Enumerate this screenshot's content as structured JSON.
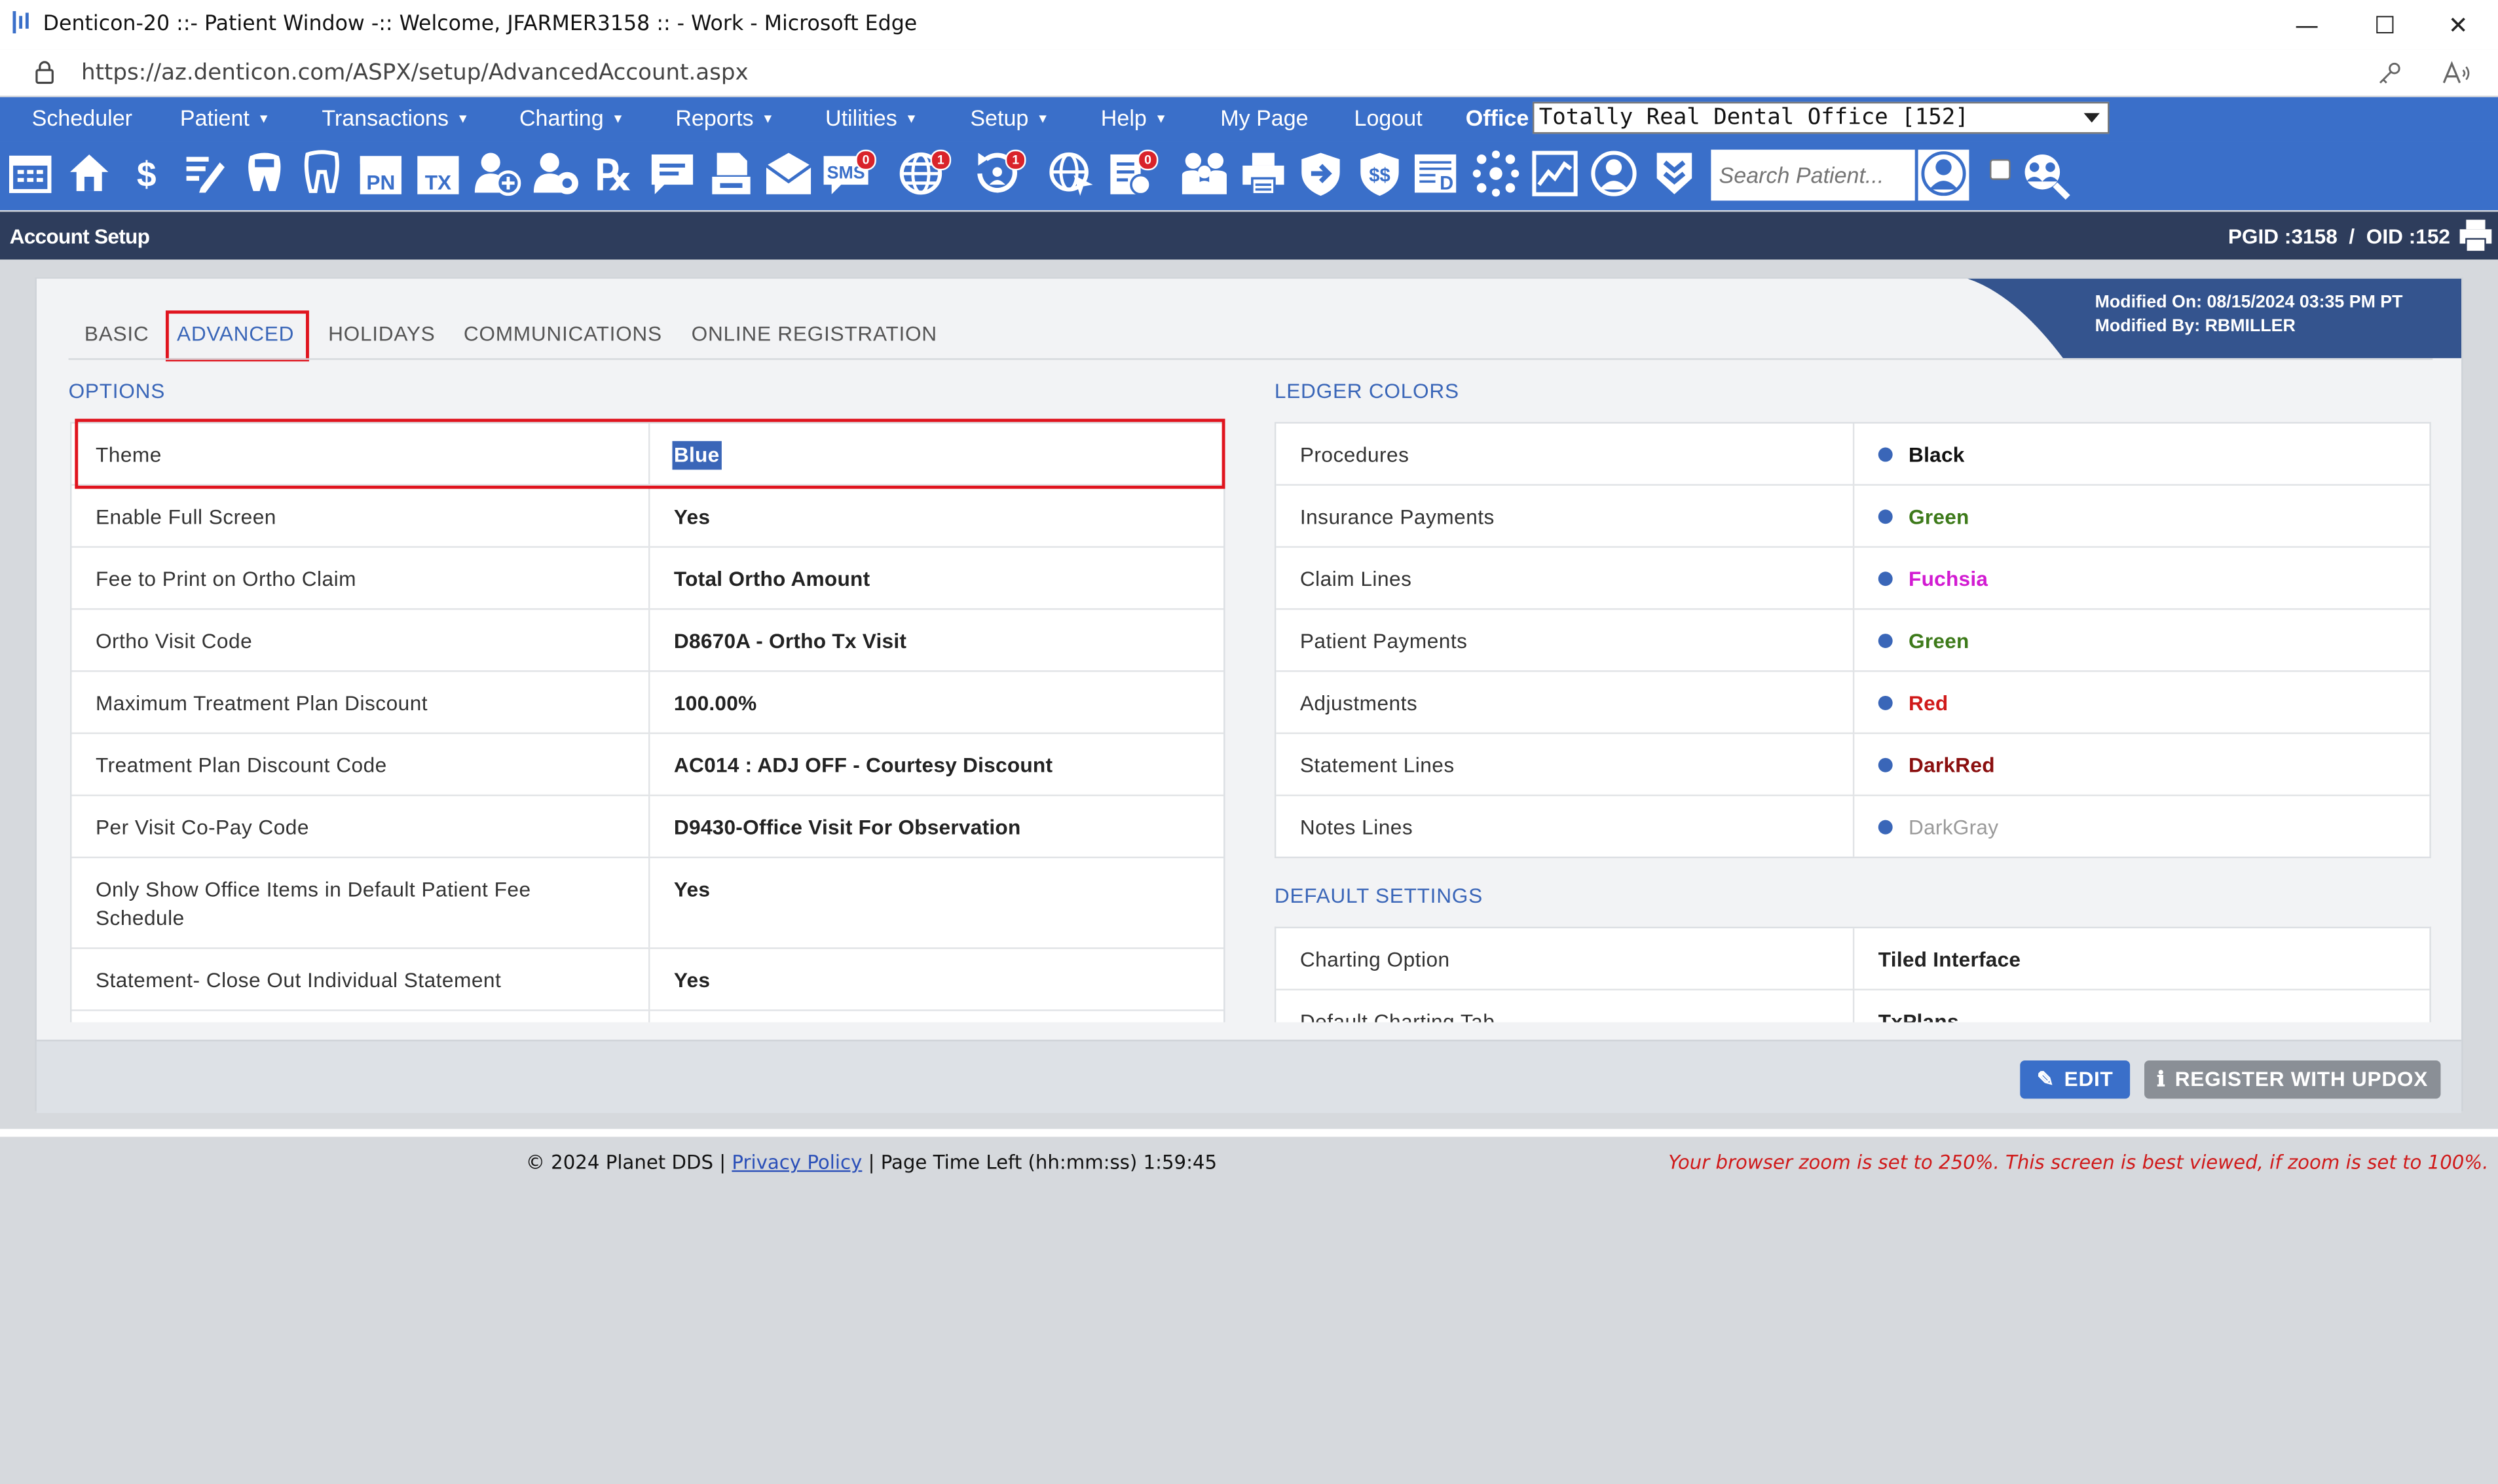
{
  "window": {
    "title": "Denticon-20 ::- Patient Window -:: Welcome, JFARMER3158 :: - Work - Microsoft Edge",
    "minimize": "—",
    "maximize": "☐",
    "close": "✕"
  },
  "browser": {
    "url": "https://az.denticon.com/ASPX/setup/AdvancedAccount.aspx"
  },
  "menu": {
    "items": [
      {
        "label": "Scheduler",
        "caret": false
      },
      {
        "label": "Patient",
        "caret": true
      },
      {
        "label": "Transactions",
        "caret": true
      },
      {
        "label": "Charting",
        "caret": true
      },
      {
        "label": "Reports",
        "caret": true
      },
      {
        "label": "Utilities",
        "caret": true
      },
      {
        "label": "Setup",
        "caret": true
      },
      {
        "label": "Help",
        "caret": true
      },
      {
        "label": "My Page",
        "caret": false
      },
      {
        "label": "Logout",
        "caret": false
      }
    ],
    "office_label": "Office",
    "office_value": "Totally Real Dental Office [152]"
  },
  "toolbar": {
    "search_placeholder": "Search Patient...",
    "badges": {
      "sms": "0",
      "globe": "1",
      "recall": "1",
      "forms": "0"
    }
  },
  "header": {
    "title": "Account Setup",
    "ids": "PGID :3158  /  OID :152"
  },
  "tabs": [
    "BASIC",
    "ADVANCED",
    "HOLIDAYS",
    "COMMUNICATIONS",
    "ONLINE REGISTRATION"
  ],
  "active_tab": "ADVANCED",
  "modified": {
    "on": "Modified On: 08/15/2024 03:35 PM PT",
    "by": "Modified By: RBMILLER"
  },
  "options": {
    "heading": "OPTIONS",
    "rows": [
      {
        "label": "Theme",
        "value": "Blue"
      },
      {
        "label": "Enable Full Screen",
        "value": "Yes"
      },
      {
        "label": "Fee to Print on Ortho Claim",
        "value": "Total Ortho Amount"
      },
      {
        "label": "Ortho Visit Code",
        "value": "D8670A - Ortho Tx Visit"
      },
      {
        "label": "Maximum Treatment Plan Discount",
        "value": "100.00%"
      },
      {
        "label": "Treatment Plan Discount Code",
        "value": "AC014 : ADJ OFF - Courtesy Discount"
      },
      {
        "label": "Per Visit Co-Pay Code",
        "value": "D9430-Office Visit For Observation"
      },
      {
        "label": "Only Show Office Items in Default Patient Fee Schedule",
        "value": "Yes"
      },
      {
        "label": "Statement- Close Out Individual Statement",
        "value": "Yes"
      }
    ]
  },
  "ledger_colors": {
    "heading": "LEDGER COLORS",
    "rows": [
      {
        "label": "Procedures",
        "value": "Black",
        "color": "#111111"
      },
      {
        "label": "Insurance Payments",
        "value": "Green",
        "color": "#3d7a1a"
      },
      {
        "label": "Claim Lines",
        "value": "Fuchsia",
        "color": "#d21bd2"
      },
      {
        "label": "Patient Payments",
        "value": "Green",
        "color": "#3d7a1a"
      },
      {
        "label": "Adjustments",
        "value": "Red",
        "color": "#d01a1a"
      },
      {
        "label": "Statement Lines",
        "value": "DarkRed",
        "color": "#8a0f0f"
      },
      {
        "label": "Notes Lines",
        "value": "DarkGray",
        "color": "#9a9a9a"
      }
    ]
  },
  "default_settings": {
    "heading": "DEFAULT SETTINGS",
    "rows": [
      {
        "label": "Charting Option",
        "value": "Tiled Interface"
      },
      {
        "label": "Default Charting Tab",
        "value": "TxPlans"
      }
    ]
  },
  "actions": {
    "edit": "EDIT",
    "register": "REGISTER WITH UPDOX"
  },
  "footer": {
    "copyright": "© 2024 Planet DDS",
    "privacy": "Privacy Policy",
    "time_left": "Page Time Left (hh:mm:ss) 1:59:45",
    "zoom_warning": "Your browser zoom is set to 250%. This screen is best viewed, if zoom is set to 100%."
  }
}
